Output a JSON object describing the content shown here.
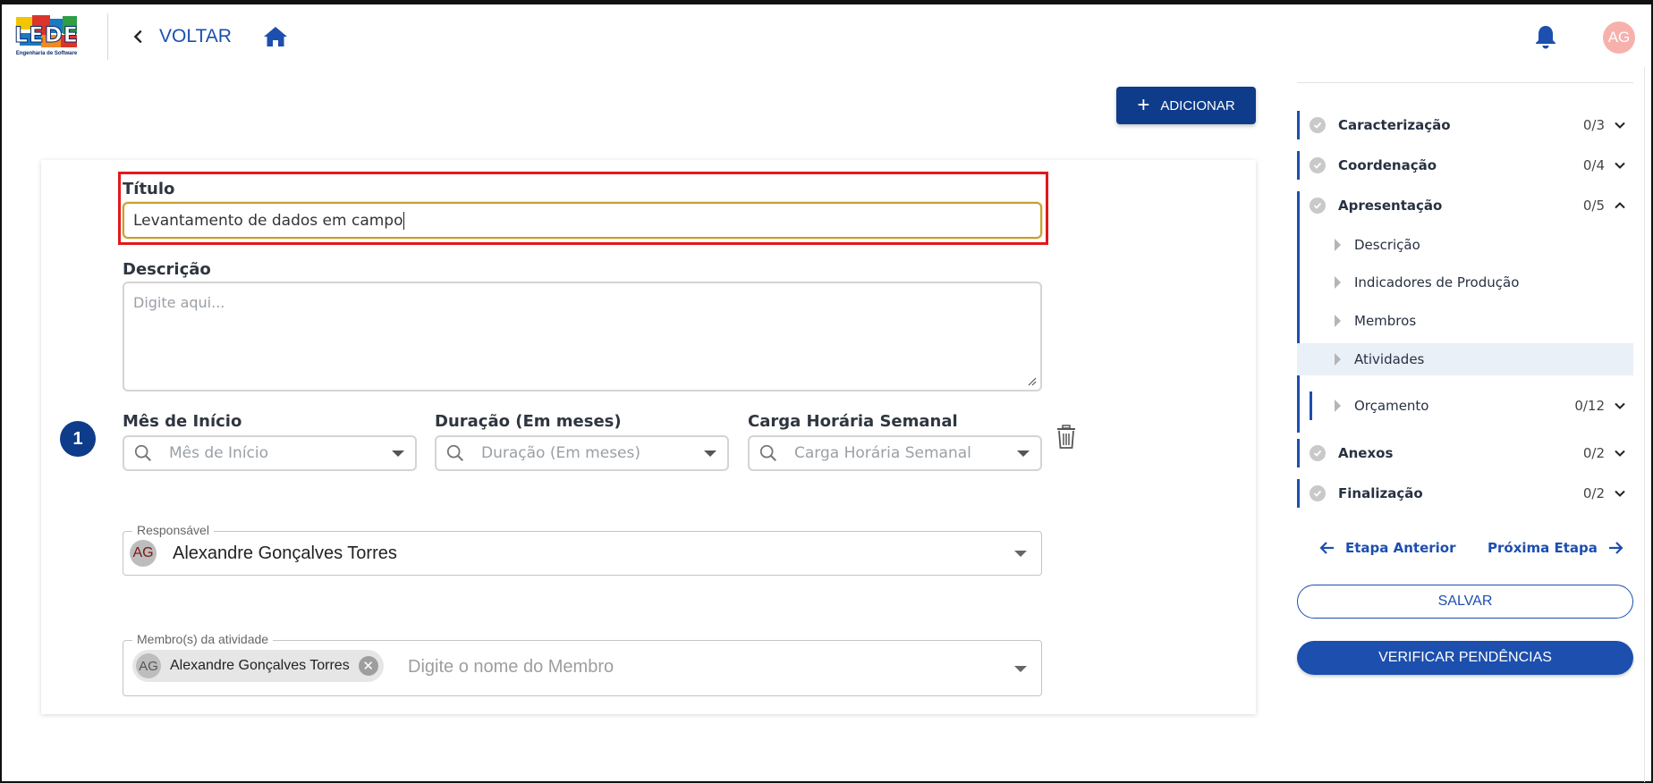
{
  "header": {
    "logo_text": "LEDES",
    "logo_sub": "Engenharia de Software",
    "back_label": "VOLTAR",
    "user_initials": "AG"
  },
  "toolbar": {
    "add_label": "ADICIONAR"
  },
  "form": {
    "step_number": "1",
    "title_label": "Título",
    "title_value": "Levantamento de dados em campo",
    "description_label": "Descrição",
    "description_placeholder": "Digite aqui...",
    "start_month_label": "Mês de Início",
    "start_month_placeholder": "Mês de Início",
    "duration_label": "Duração (Em meses)",
    "duration_placeholder": "Duração (Em meses)",
    "weekly_hours_label": "Carga Horária Semanal",
    "weekly_hours_placeholder": "Carga Horária Semanal",
    "responsible_legend": "Responsável",
    "responsible_initials": "AG",
    "responsible_name": "Alexandre Gonçalves Torres",
    "members_legend": "Membro(s) da atividade",
    "member_chip_initials": "AG",
    "member_chip_name": "Alexandre Gonçalves Torres",
    "members_placeholder": "Digite o nome do Membro"
  },
  "sidebar": {
    "sections": [
      {
        "label": "Caracterização",
        "count": "0/3"
      },
      {
        "label": "Coordenação",
        "count": "0/4"
      },
      {
        "label": "Apresentação",
        "count": "0/5"
      },
      {
        "label": "Anexos",
        "count": "0/2"
      },
      {
        "label": "Finalização",
        "count": "0/2"
      }
    ],
    "subitems": [
      {
        "label": "Descrição"
      },
      {
        "label": "Indicadores de Produção"
      },
      {
        "label": "Membros"
      },
      {
        "label": "Atividades"
      }
    ],
    "budget": {
      "label": "Orçamento",
      "count": "0/12"
    },
    "prev_label": "Etapa Anterior",
    "next_label": "Próxima Etapa",
    "save_label": "SALVAR",
    "verify_label": "VERIFICAR PENDÊNCIAS"
  },
  "colors": {
    "primary": "#1c4fae",
    "primary_dark": "#0e3c8a",
    "highlight": "#e3181b",
    "avatar": "#f7b1ad"
  }
}
